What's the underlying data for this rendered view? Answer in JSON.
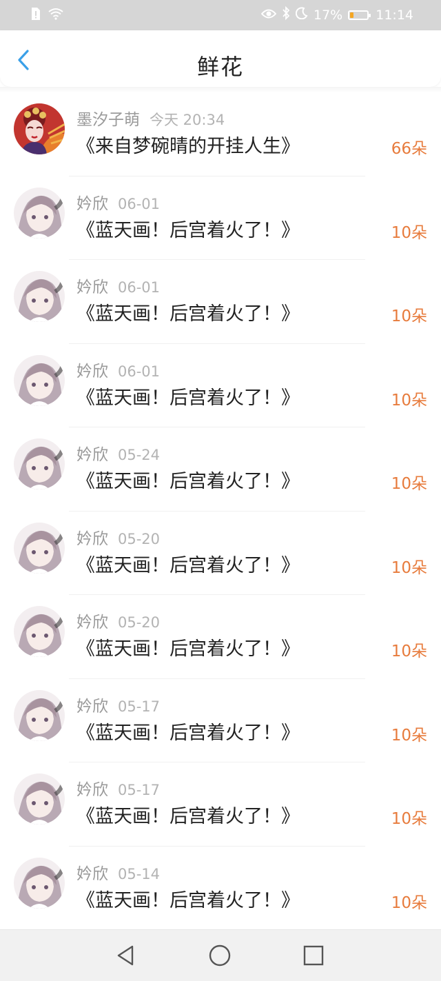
{
  "status_bar": {
    "battery_percent": "17%",
    "battery_level": 0.17,
    "time": "11:14",
    "icons": [
      "sim-alert-icon",
      "wifi-icon",
      "eye-icon",
      "bluetooth-icon",
      "moon-icon",
      "battery-icon"
    ]
  },
  "header": {
    "title": "鲜花",
    "back_icon": "chevron-left-icon"
  },
  "colors": {
    "accent": "#e77b3c",
    "back": "#3aa0e8",
    "name": "#9a9a9a",
    "time": "#b3b3b3",
    "title": "#222222"
  },
  "records": [
    {
      "name": "墨汐子萌",
      "time": "今天 20:34",
      "book": "《来自梦碗晴的开挂人生》",
      "amount": "66朵",
      "avatar": "opera"
    },
    {
      "name": "妗欣",
      "time": "06-01",
      "book": "《蓝天画！后宫着火了！》",
      "amount": "10朵",
      "avatar": "girl"
    },
    {
      "name": "妗欣",
      "time": "06-01",
      "book": "《蓝天画！后宫着火了！》",
      "amount": "10朵",
      "avatar": "girl"
    },
    {
      "name": "妗欣",
      "time": "06-01",
      "book": "《蓝天画！后宫着火了！》",
      "amount": "10朵",
      "avatar": "girl"
    },
    {
      "name": "妗欣",
      "time": "05-24",
      "book": "《蓝天画！后宫着火了！》",
      "amount": "10朵",
      "avatar": "girl"
    },
    {
      "name": "妗欣",
      "time": "05-20",
      "book": "《蓝天画！后宫着火了！》",
      "amount": "10朵",
      "avatar": "girl"
    },
    {
      "name": "妗欣",
      "time": "05-20",
      "book": "《蓝天画！后宫着火了！》",
      "amount": "10朵",
      "avatar": "girl"
    },
    {
      "name": "妗欣",
      "time": "05-17",
      "book": "《蓝天画！后宫着火了！》",
      "amount": "10朵",
      "avatar": "girl"
    },
    {
      "name": "妗欣",
      "time": "05-17",
      "book": "《蓝天画！后宫着火了！》",
      "amount": "10朵",
      "avatar": "girl"
    },
    {
      "name": "妗欣",
      "time": "05-14",
      "book": "《蓝天画！后宫着火了！》",
      "amount": "10朵",
      "avatar": "girl"
    }
  ],
  "nav_bar": {
    "buttons": [
      "back-triangle-icon",
      "home-circle-icon",
      "recents-square-icon"
    ]
  }
}
